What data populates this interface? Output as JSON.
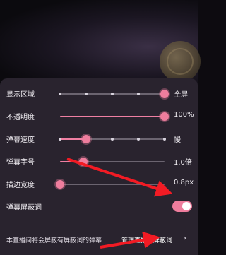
{
  "player": {
    "background_icon": "coin-emblem-icon"
  },
  "settings": {
    "display_area": {
      "label": "显示区域",
      "value": "全屏",
      "level": 1.0,
      "steps": 5
    },
    "opacity": {
      "label": "不透明度",
      "value": "100%",
      "level": 1.0
    },
    "speed": {
      "label": "弹幕速度",
      "value": "慢",
      "level": 0.25,
      "steps": 5
    },
    "font_size": {
      "label": "弹幕字号",
      "value": "1.0倍",
      "level": 0.22
    },
    "stroke_width": {
      "label": "描边宽度",
      "value": "0.8px",
      "level": 0.0
    },
    "block_words": {
      "label": "弹幕屏蔽词",
      "enabled": true
    }
  },
  "footer": {
    "text": "本直播间将会屏蔽有屏蔽词的弹幕",
    "link": "管理直播间屏蔽词",
    "chevron_icon": "chevron-right-icon"
  },
  "colors": {
    "accent": "#ee7d9d",
    "arrow": "#f21b24",
    "panel": "#29232e"
  }
}
